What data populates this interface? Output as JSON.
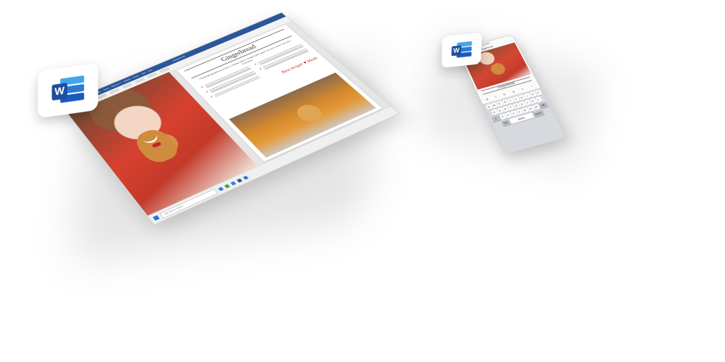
{
  "desktop": {
    "window": {
      "ribbon_tabs": [
        "File",
        "Home",
        "Insert",
        "Draw",
        "Design",
        "Layout",
        "References",
        "Mailings",
        "Review",
        "View",
        "Help"
      ],
      "doc_name": "Gingerbread"
    },
    "document": {
      "title": "Gingerbread",
      "intro": "This simple gingerbread recipe is a holiday classic. Gingerbread cookies are easy, sweet, and easy to decorate.",
      "note": "Best recipe! ♥ Mom"
    },
    "taskbar": {
      "search_placeholder": "Type here to search"
    }
  },
  "phone": {
    "status_time": "9:41 AM",
    "doc_name": "Gingerbread",
    "heading": "Gingerbread",
    "format_buttons": [
      "B",
      "I",
      "U",
      "A",
      "≡",
      "⋯"
    ],
    "keyboard": {
      "row1": [
        "Q",
        "W",
        "E",
        "R",
        "T",
        "Y",
        "U",
        "I",
        "O",
        "P"
      ],
      "row2": [
        "A",
        "S",
        "D",
        "F",
        "G",
        "H",
        "J",
        "K",
        "L"
      ],
      "row3": [
        "Z",
        "X",
        "C",
        "V",
        "B",
        "N",
        "M"
      ],
      "space": "space",
      "return": "return"
    }
  },
  "icons": {
    "word_letter": "W",
    "colors": {
      "word_dark": "#185abd",
      "word_mid": "#2b7cd3",
      "word_light": "#41a5ee",
      "accent_red": "#c8202a"
    }
  }
}
